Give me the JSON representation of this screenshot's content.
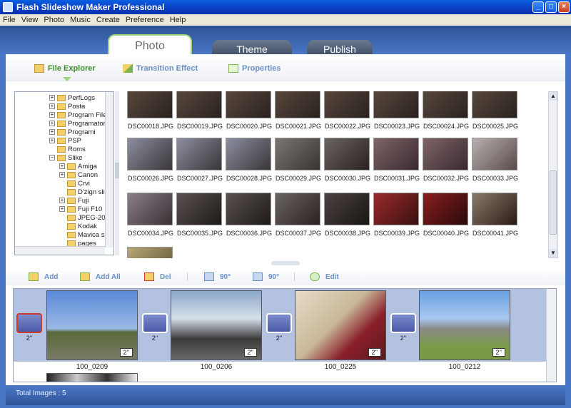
{
  "window": {
    "title": "Flash Slideshow Maker Professional"
  },
  "menu": [
    "File",
    "View",
    "Photo",
    "Music",
    "Create",
    "Preference",
    "Help"
  ],
  "tabs": [
    "Photo",
    "Theme",
    "Publish"
  ],
  "subtabs": [
    "File Explorer",
    "Transition Effect",
    "Properties"
  ],
  "tree": [
    "PerfLogs",
    "Posta",
    "Program Files",
    "Programator",
    "Programi",
    "PSP",
    "Roms",
    "Slike",
    "Amiga",
    "Canon",
    "Crvi",
    "D'zign sli",
    "Fuji",
    "Fuji F10",
    "JPEG-20",
    "Kodak",
    "Mavica s",
    "pages"
  ],
  "thumbs": [
    "DSC00018.JPG",
    "DSC00019.JPG",
    "DSC00020.JPG",
    "DSC00021.JPG",
    "DSC00022.JPG",
    "DSC00023.JPG",
    "DSC00024.JPG",
    "DSC00025.JPG",
    "DSC00026.JPG",
    "DSC00027.JPG",
    "DSC00028.JPG",
    "DSC00029.JPG",
    "DSC00030.JPG",
    "DSC00031.JPG",
    "DSC00032.JPG",
    "DSC00033.JPG",
    "DSC00034.JPG",
    "DSC00035.JPG",
    "DSC00036.JPG",
    "DSC00037.JPG",
    "DSC00038.JPG",
    "DSC00039.JPG",
    "DSC00040.JPG",
    "DSC00041.JPG"
  ],
  "toolbar": {
    "add": "Add",
    "add_all": "Add All",
    "del": "Del",
    "rotate_left": "90°",
    "rotate_right": "90°",
    "edit": "Edit"
  },
  "slides": [
    {
      "name": "100_0209",
      "duration": "2''"
    },
    {
      "name": "100_0206",
      "duration": "2''"
    },
    {
      "name": "100_0225",
      "duration": "2''"
    },
    {
      "name": "100_0212",
      "duration": "2''"
    }
  ],
  "transition_duration": "2''",
  "status": {
    "text": "Total Images : 5"
  }
}
